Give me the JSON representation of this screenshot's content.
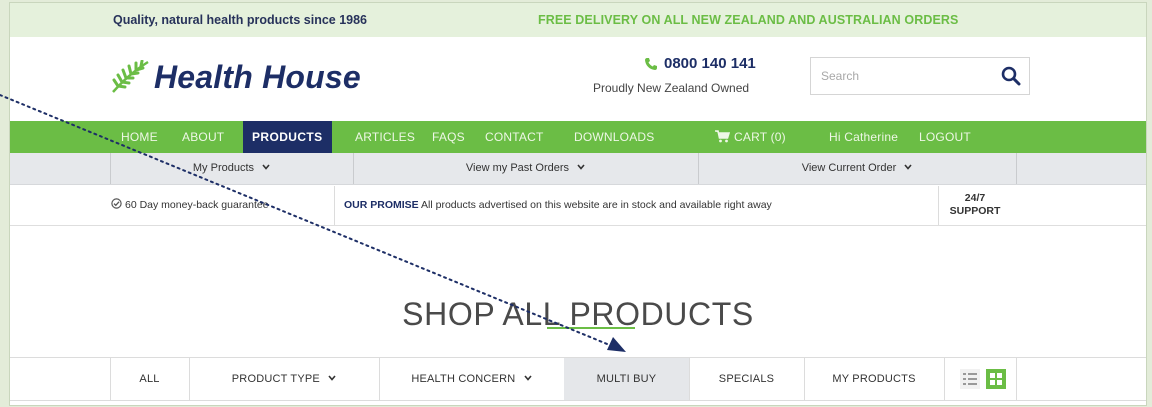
{
  "topbar": {
    "tagline": "Quality, natural health products since 1986",
    "free_delivery": "FREE DELIVERY ON ALL NEW ZEALAND AND AUSTRALIAN ORDERS"
  },
  "header": {
    "logo_text": "Health House",
    "phone": "0800 140 141",
    "owned": "Proudly New Zealand Owned",
    "search_placeholder": "Search"
  },
  "nav": {
    "items": [
      "HOME",
      "ABOUT",
      "PRODUCTS",
      "ARTICLES",
      "FAQS",
      "CONTACT",
      "DOWNLOADS"
    ],
    "cart": "CART (0)",
    "greeting": "Hi Catherine",
    "logout": "LOGOUT",
    "active": "PRODUCTS"
  },
  "subnav": {
    "my_products": "My Products",
    "past_orders": "View my Past Orders",
    "current_order": "View Current Order"
  },
  "promise": {
    "guarantee": "60 Day money-back guarantee",
    "promise_label": "OUR PROMISE",
    "promise_text": "All products advertised on this website are in stock and available right away",
    "support_line1": "24/7",
    "support_line2": "SUPPORT"
  },
  "main": {
    "title": "SHOP ALL PRODUCTS"
  },
  "filters": {
    "all": "ALL",
    "product_type": "PRODUCT TYPE",
    "health_concern": "HEALTH CONCERN",
    "multi_buy": "MULTI BUY",
    "specials": "SPECIALS",
    "my_products": "MY PRODUCTS",
    "active": "MULTI BUY"
  },
  "colors": {
    "brand_green": "#6bbd45",
    "brand_navy": "#1d2e66",
    "page_background": "#e3ecd9",
    "annotation_arrow": "#1d2e66"
  },
  "icons": [
    "fern-logo-icon",
    "phone-icon",
    "search-icon",
    "cart-icon",
    "chevron-down-icon",
    "check-circle-icon",
    "list-view-icon",
    "grid-view-icon"
  ]
}
